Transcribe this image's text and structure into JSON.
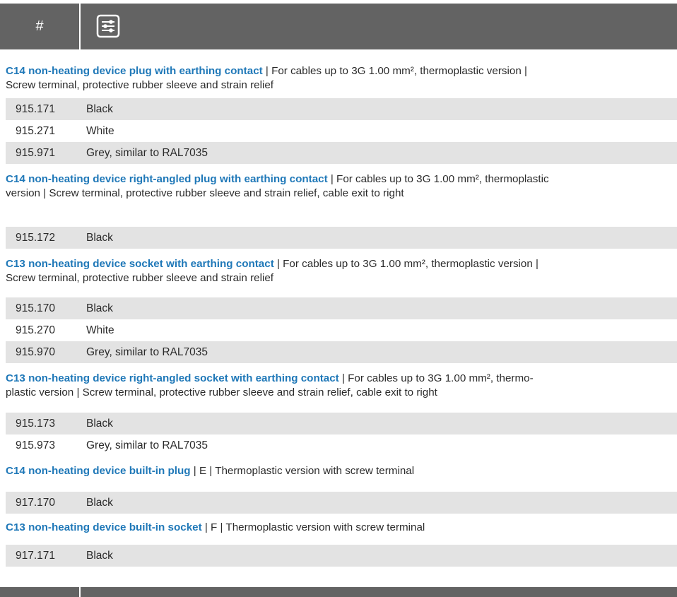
{
  "header": {
    "hash_label": "#",
    "icon": "filter-sliders-icon"
  },
  "sections": [
    {
      "title": "C14 non-heating device plug with earthing contact",
      "line1_rest": " | For cables up to 3G 1.00 mm², thermoplastic version |",
      "line2": "Screw terminal, protective rubber sleeve and strain relief",
      "rows": [
        {
          "code": "915.171",
          "desc": "Black"
        },
        {
          "code": "915.271",
          "desc": "White"
        },
        {
          "code": "915.971",
          "desc": "Grey, similar to RAL7035"
        }
      ]
    },
    {
      "title": "C14 non-heating device right-angled plug with earthing contact",
      "line1_rest": " | For cables up to 3G 1.00 mm², thermoplastic",
      "line2": "version | Screw terminal, protective rubber sleeve and strain relief, cable exit to right",
      "rows": [
        {
          "code": "915.172",
          "desc": "Black"
        }
      ]
    },
    {
      "title": "C13 non-heating device socket with earthing contact",
      "line1_rest": " | For cables up to 3G 1.00 mm², thermoplastic version |",
      "line2": "Screw terminal, protective rubber sleeve and strain relief",
      "rows": [
        {
          "code": "915.170",
          "desc": "Black"
        },
        {
          "code": "915.270",
          "desc": "White"
        },
        {
          "code": "915.970",
          "desc": "Grey, similar to RAL7035"
        }
      ]
    },
    {
      "title": "C13 non-heating device right-angled socket with earthing contact",
      "line1_rest": " | For cables up to 3G 1.00 mm², thermo-",
      "line2": "plastic version | Screw terminal, protective rubber sleeve and strain relief, cable exit to right",
      "rows": [
        {
          "code": "915.173",
          "desc": "Black"
        },
        {
          "code": "915.973",
          "desc": "Grey, similar to RAL7035"
        }
      ]
    },
    {
      "title": "C14 non-heating device built-in plug",
      "line1_rest": "  | E | Thermoplastic version with screw terminal",
      "rows": [
        {
          "code": "917.170",
          "desc": "Black"
        }
      ]
    },
    {
      "title": "C13 non-heating device built-in socket",
      "line1_rest": "  | F | Thermoplastic version with screw terminal",
      "rows": [
        {
          "code": "917.171",
          "desc": "Black"
        }
      ]
    }
  ]
}
